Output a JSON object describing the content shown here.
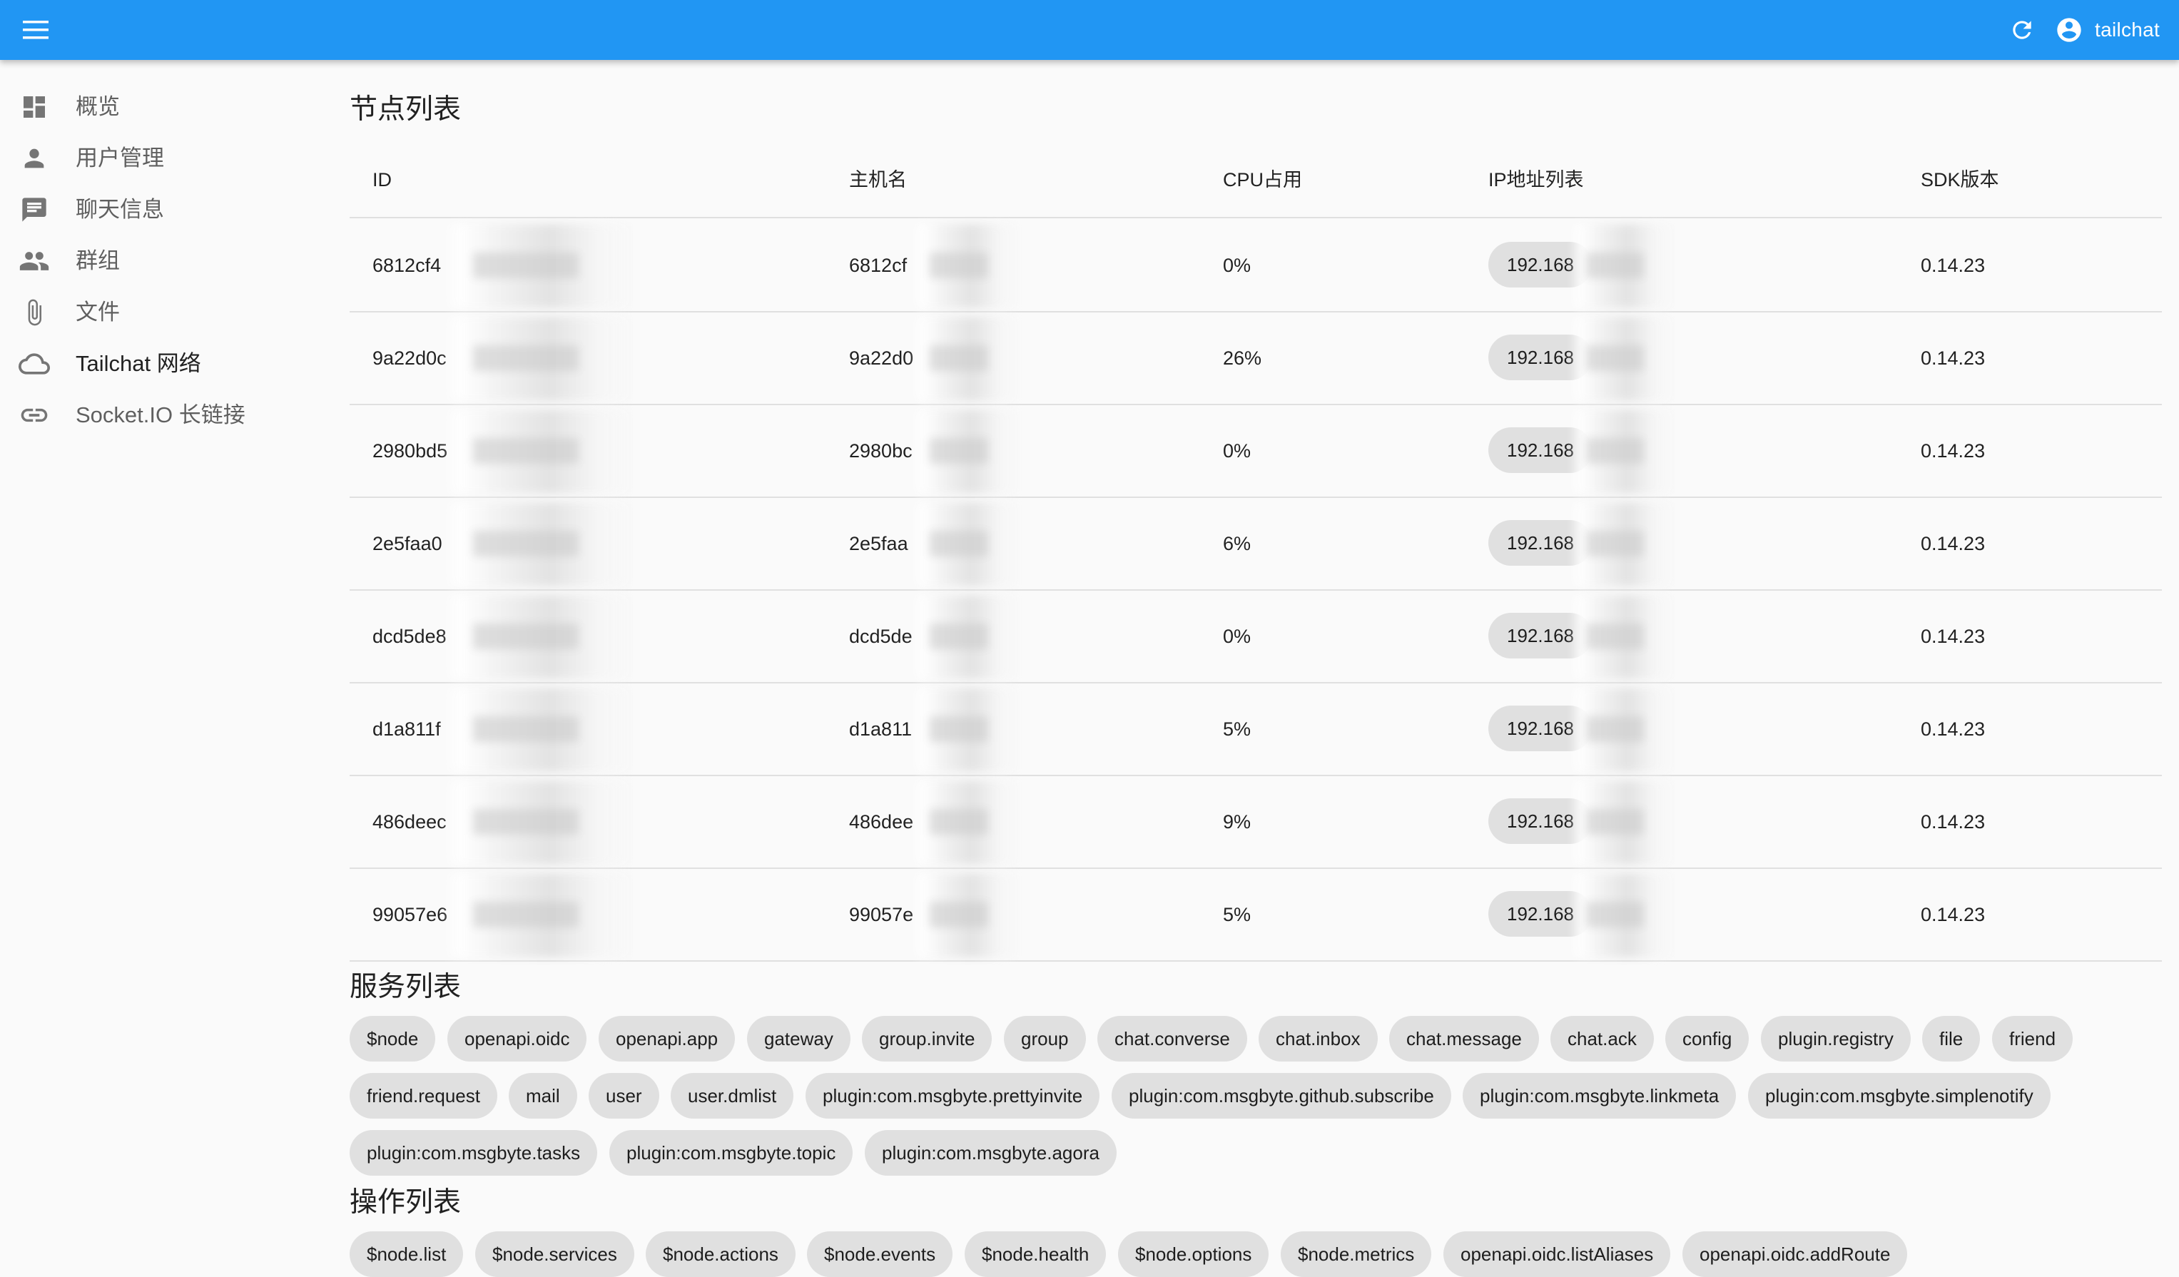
{
  "app": {
    "user_name": "tailchat"
  },
  "sidebar": {
    "items": [
      {
        "label": "概览"
      },
      {
        "label": "用户管理"
      },
      {
        "label": "聊天信息"
      },
      {
        "label": "群组"
      },
      {
        "label": "文件"
      },
      {
        "label": "Tailchat 网络"
      },
      {
        "label": "Socket.IO 长链接"
      }
    ]
  },
  "nodes": {
    "title": "节点列表",
    "headers": [
      "ID",
      "主机名",
      "CPU占用",
      "IP地址列表",
      "SDK版本"
    ],
    "rows": [
      {
        "id": "6812cf4",
        "host": "6812cf",
        "cpu": "0%",
        "ip": "192.168",
        "sdk": "0.14.23"
      },
      {
        "id": "9a22d0c",
        "host": "9a22d0",
        "cpu": "26%",
        "ip": "192.168",
        "sdk": "0.14.23"
      },
      {
        "id": "2980bd5",
        "host": "2980bc",
        "cpu": "0%",
        "ip": "192.168",
        "sdk": "0.14.23"
      },
      {
        "id": "2e5faa0",
        "host": "2e5faa",
        "cpu": "6%",
        "ip": "192.168",
        "sdk": "0.14.23"
      },
      {
        "id": "dcd5de8",
        "host": "dcd5de",
        "cpu": "0%",
        "ip": "192.168",
        "sdk": "0.14.23"
      },
      {
        "id": "d1a811f",
        "host": "d1a811",
        "cpu": "5%",
        "ip": "192.168",
        "sdk": "0.14.23"
      },
      {
        "id": "486deec",
        "host": "486dee",
        "cpu": "9%",
        "ip": "192.168",
        "sdk": "0.14.23"
      },
      {
        "id": "99057e6",
        "host": "99057e",
        "cpu": "5%",
        "ip": "192.168",
        "sdk": "0.14.23"
      }
    ]
  },
  "services": {
    "title": "服务列表",
    "items": [
      "$node",
      "openapi.oidc",
      "openapi.app",
      "gateway",
      "group.invite",
      "group",
      "chat.converse",
      "chat.inbox",
      "chat.message",
      "chat.ack",
      "config",
      "plugin.registry",
      "file",
      "friend",
      "friend.request",
      "mail",
      "user",
      "user.dmlist",
      "plugin:com.msgbyte.prettyinvite",
      "plugin:com.msgbyte.github.subscribe",
      "plugin:com.msgbyte.linkmeta",
      "plugin:com.msgbyte.simplenotify",
      "plugin:com.msgbyte.tasks",
      "plugin:com.msgbyte.topic",
      "plugin:com.msgbyte.agora"
    ]
  },
  "actions": {
    "title": "操作列表",
    "items": [
      "$node.list",
      "$node.services",
      "$node.actions",
      "$node.events",
      "$node.health",
      "$node.options",
      "$node.metrics",
      "openapi.oidc.listAliases",
      "openapi.oidc.addRoute"
    ]
  },
  "colors": {
    "appbar": "#2196f3",
    "chip": "#e0e0e0",
    "background": "#fafafa"
  }
}
